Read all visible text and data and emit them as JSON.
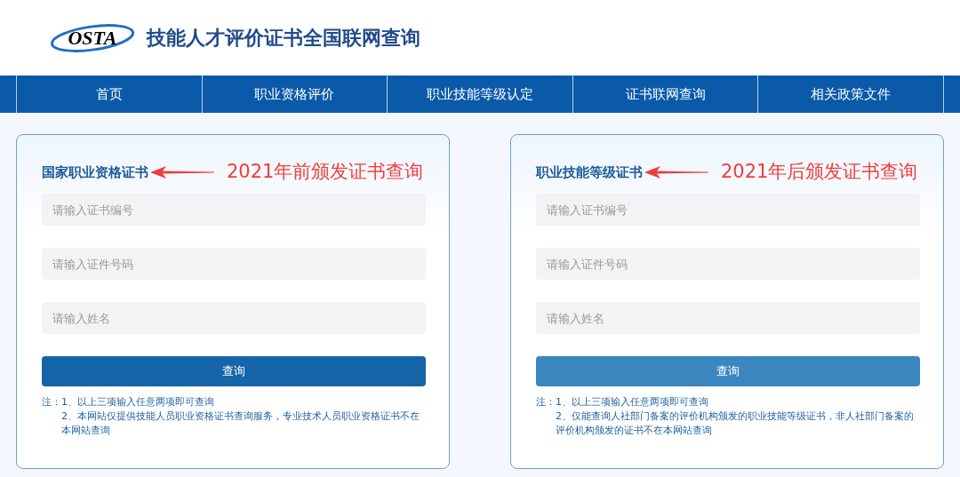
{
  "header": {
    "logo_text": "OSTA",
    "title": "技能人才评价证书全国联网查询"
  },
  "nav": [
    {
      "label": "首页"
    },
    {
      "label": "职业资格评价"
    },
    {
      "label": "职业技能等级认定"
    },
    {
      "label": "证书联网查询"
    },
    {
      "label": "相关政策文件"
    }
  ],
  "cards": [
    {
      "title": "国家职业资格证书",
      "annotation": "2021年前颁发证书查询",
      "fields": [
        {
          "placeholder": "请输入证书编号"
        },
        {
          "placeholder": "请输入证件号码"
        },
        {
          "placeholder": "请输入姓名"
        }
      ],
      "button": {
        "label": "查询",
        "kind": "dark"
      },
      "note_label": "注：",
      "notes": [
        "1、以上三项输入任意两项即可查询",
        "2、本网站仅提供技能人员职业资格证书查询服务，专业技术人员职业资格证书不在本网站查询"
      ]
    },
    {
      "title": "职业技能等级证书",
      "annotation": "2021年后颁发证书查询",
      "fields": [
        {
          "placeholder": "请输入证书编号"
        },
        {
          "placeholder": "请输入证件号码"
        },
        {
          "placeholder": "请输入姓名"
        }
      ],
      "button": {
        "label": "查询",
        "kind": "light"
      },
      "note_label": "注：",
      "notes": [
        "1、以上三项输入任意两项即可查询",
        "2、仅能查询人社部门备案的评价机构颁发的职业技能等级证书，非人社部门备案的评价机构颁发的证书不在本网站查询"
      ]
    }
  ]
}
